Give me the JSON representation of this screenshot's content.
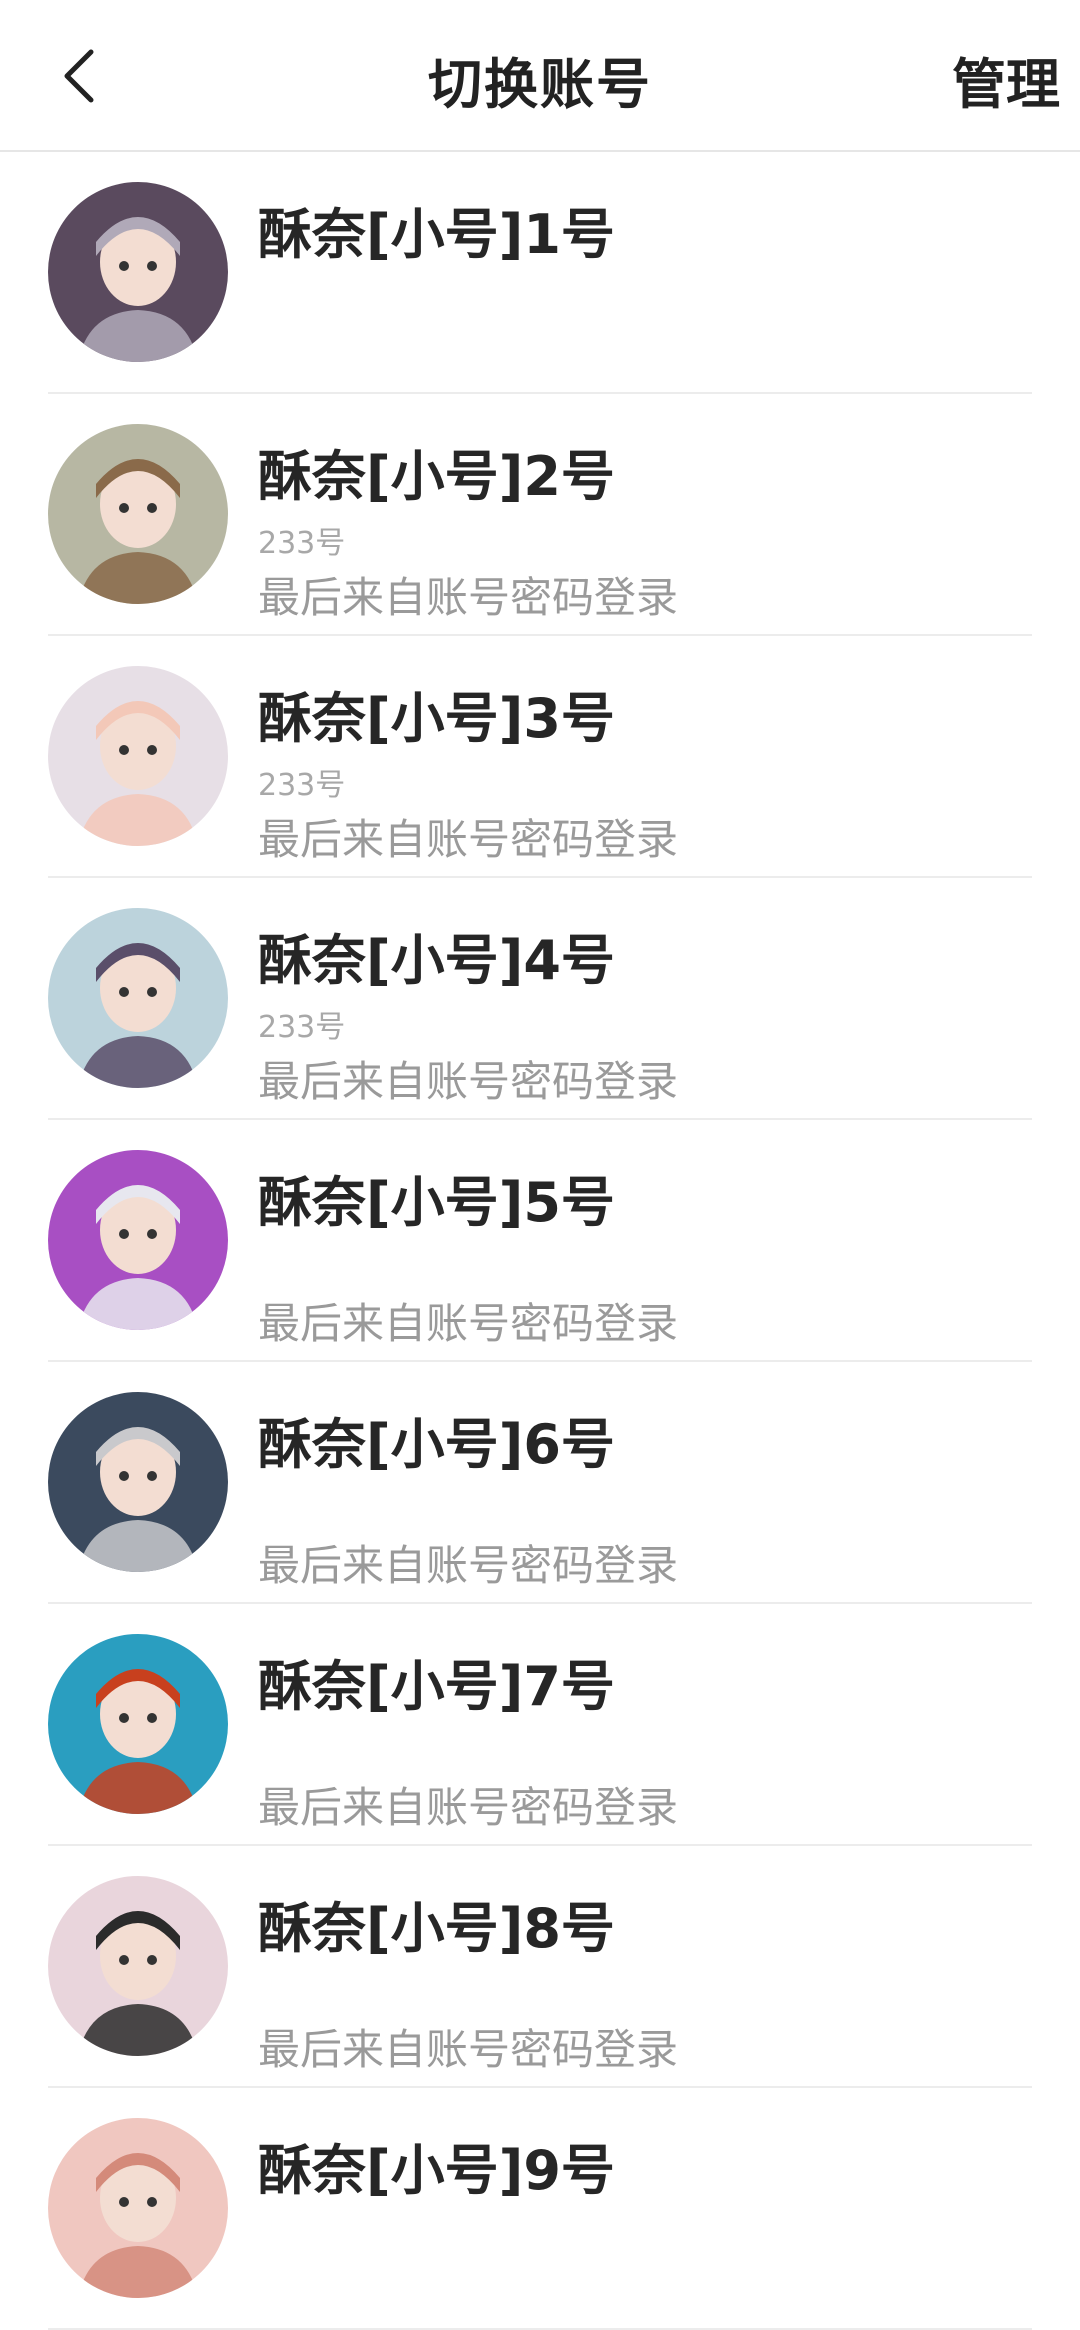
{
  "header": {
    "back_icon": "chevron-left-icon",
    "title": "切换账号",
    "manage_label": "管理"
  },
  "accounts": [
    {
      "name": "酥奈[小号]1号",
      "sub": "",
      "login": "",
      "avatar_bg": "#5a4a5e",
      "accent": "#b0a9b8"
    },
    {
      "name": "酥奈[小号]2号",
      "sub": "233号",
      "login": "最后来自账号密码登录",
      "avatar_bg": "#b7b7a3",
      "accent": "#8a6a4a"
    },
    {
      "name": "酥奈[小号]3号",
      "sub": "233号",
      "login": "最后来自账号密码登录",
      "avatar_bg": "#e7dfe6",
      "accent": "#f3c8b8"
    },
    {
      "name": "酥奈[小号]4号",
      "sub": "233号",
      "login": "最后来自账号密码登录",
      "avatar_bg": "#bcd3dc",
      "accent": "#5a4e6a"
    },
    {
      "name": "酥奈[小号]5号",
      "sub": "",
      "login": "最后来自账号密码登录",
      "avatar_bg": "#a84fc3",
      "accent": "#e7e7ef"
    },
    {
      "name": "酥奈[小号]6号",
      "sub": "",
      "login": "最后来自账号密码登录",
      "avatar_bg": "#3b4a5e",
      "accent": "#c9c9cc"
    },
    {
      "name": "酥奈[小号]7号",
      "sub": "",
      "login": "最后来自账号密码登录",
      "avatar_bg": "#2a9ec0",
      "accent": "#c8401e"
    },
    {
      "name": "酥奈[小号]8号",
      "sub": "",
      "login": "最后来自账号密码登录",
      "avatar_bg": "#e9d5dc",
      "accent": "#2b2b2b"
    },
    {
      "name": "酥奈[小号]9号",
      "sub": "",
      "login": "",
      "avatar_bg": "#f0c7c0",
      "accent": "#d48a7a"
    }
  ]
}
